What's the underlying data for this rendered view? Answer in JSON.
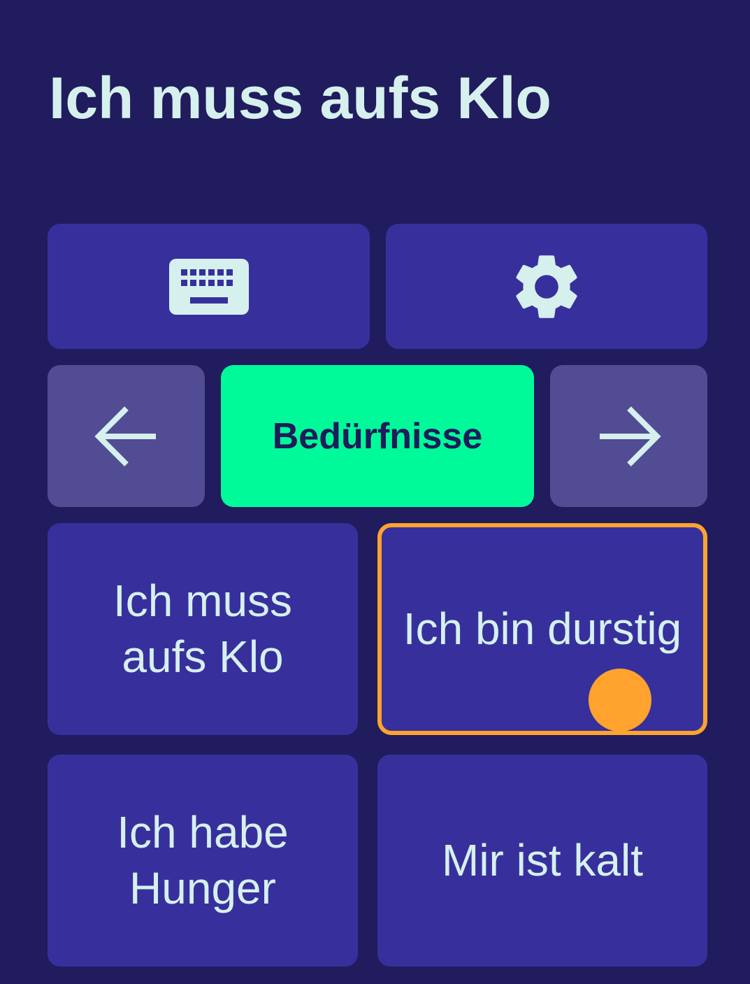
{
  "header": {
    "title": "Ich muss aufs Klo"
  },
  "toolbar": {
    "keyboard_icon": "keyboard-icon",
    "settings_icon": "gear-icon"
  },
  "category_nav": {
    "prev_icon": "arrow-left-icon",
    "next_icon": "arrow-right-icon",
    "current_label": "Bedürfnisse"
  },
  "phrases": [
    {
      "label": "Ich muss aufs Klo",
      "selected": false
    },
    {
      "label": "Ich bin durstig",
      "selected": true
    },
    {
      "label": "Ich habe Hunger",
      "selected": false
    },
    {
      "label": "Mir ist kalt",
      "selected": false
    }
  ],
  "colors": {
    "background": "#201c5e",
    "tile": "#37309c",
    "nav_tile": "#514c94",
    "category_active": "#00fa9a",
    "text_light": "#d6f0ee",
    "text_dark": "#1e1c5a",
    "selection": "#ffa32e"
  }
}
